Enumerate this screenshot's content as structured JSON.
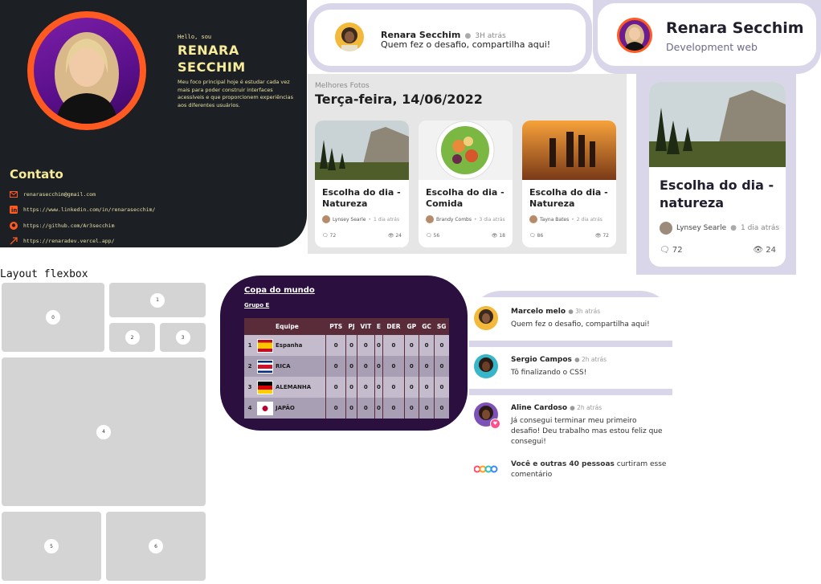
{
  "portfolio": {
    "greeting": "Hello, sou",
    "name_line1": "RENARA",
    "name_line2": "SECCHIM",
    "bio": "Meu foco principal hoje é estudar cada vez mais para poder construir interfaces acessíveis e que proporcionem experiências aos diferentes usuários.",
    "contact_title": "Contato",
    "contacts": [
      {
        "icon": "email-icon",
        "text": "renarasecchim@gmail.com"
      },
      {
        "icon": "linkedin-icon",
        "text": "https://www.linkedin.com/in/renarasecchim/"
      },
      {
        "icon": "github-icon",
        "text": "https://github.com/Ar3secchim"
      },
      {
        "icon": "external-link-icon",
        "text": "https://renaradev.vercel.app/"
      }
    ],
    "accent": "#ff5a1f"
  },
  "comment_card": {
    "name": "Renara Secchim",
    "time": "3H atrás",
    "text": "Quem fez o desafio, compartilha aqui!"
  },
  "profile": {
    "name": "Renara Secchim",
    "role": "Development web"
  },
  "fotos": {
    "label": "Melhores Fotos",
    "date": "Terça-feira, 14/06/2022",
    "cards": [
      {
        "title": "Escolha do dia - Natureza",
        "author": "Lynsey Searle",
        "time": "1 dia atrás",
        "comments": "72",
        "views": "24"
      },
      {
        "title": "Escolha do dia - Comida",
        "author": "Brandy Combs",
        "time": "3 dia atrás",
        "comments": "56",
        "views": "18"
      },
      {
        "title": "Escolha do dia - Natureza",
        "author": "Tayna Bates",
        "time": "2 dia atrás",
        "comments": "86",
        "views": "72"
      }
    ]
  },
  "big_foto": {
    "title": "Escolha do dia - natureza",
    "author": "Lynsey Searle",
    "time": "1 dia atrás",
    "comments": "72",
    "views": "24"
  },
  "flexbox": {
    "title": "Layout flexbox",
    "boxes": [
      "0",
      "1",
      "2",
      "3",
      "4",
      "5",
      "6"
    ]
  },
  "copa": {
    "title": "Copa do mundo",
    "group": "Grupo E",
    "headers": [
      "Equipe",
      "PTS",
      "PJ",
      "VIT",
      "E",
      "DER",
      "GP",
      "GC",
      "SG"
    ],
    "rows": [
      {
        "pos": "1",
        "team": "Espanha",
        "stats": [
          "0",
          "0",
          "0",
          "0",
          "0",
          "0",
          "0",
          "0"
        ]
      },
      {
        "pos": "2",
        "team": "RICA",
        "stats": [
          "0",
          "0",
          "0",
          "0",
          "0",
          "0",
          "0",
          "0"
        ]
      },
      {
        "pos": "3",
        "team": "ALEMANHA",
        "stats": [
          "0",
          "0",
          "0",
          "0",
          "0",
          "0",
          "0",
          "0"
        ]
      },
      {
        "pos": "4",
        "team": "JAPÃO",
        "stats": [
          "0",
          "0",
          "0",
          "0",
          "0",
          "0",
          "0",
          "0"
        ]
      }
    ]
  },
  "comments": [
    {
      "name": "Marcelo melo",
      "time": "3h atrás",
      "text": "Quem fez o desafio, compartilha aqui!"
    },
    {
      "name": "Sergio Campos",
      "time": "2h atrás",
      "text": "Tô finalizando o CSS!"
    },
    {
      "name": "Aline Cardoso",
      "time": "2h atrás",
      "text": "Já consegui terminar meu primeiro desafio! Deu trabalho mas estou feliz que consegui!"
    }
  ],
  "likes": {
    "bold": "Você e outras 40 pessoas",
    "rest": " curtiram esse comentário"
  }
}
